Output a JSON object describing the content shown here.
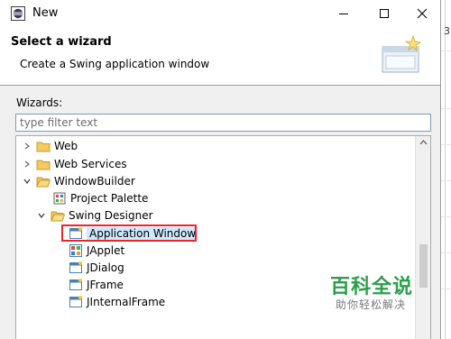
{
  "window": {
    "title": "New",
    "minimize_glyph": "—",
    "maximize_glyph": "☐",
    "close_glyph": "✕"
  },
  "header": {
    "title": "Select a wizard",
    "subtitle": "Create a Swing application window"
  },
  "wizards": {
    "label": "Wizards:",
    "filter_placeholder": "type filter text",
    "filter_value": ""
  },
  "tree": {
    "items": [
      {
        "label": "Web",
        "depth": 0,
        "expanded": false,
        "icon": "folder-icon"
      },
      {
        "label": "Web Services",
        "depth": 0,
        "expanded": false,
        "icon": "folder-icon"
      },
      {
        "label": "WindowBuilder",
        "depth": 0,
        "expanded": true,
        "icon": "folder-open-icon"
      },
      {
        "label": "Project Palette",
        "depth": 1,
        "icon": "palette-icon"
      },
      {
        "label": "Swing Designer",
        "depth": 1,
        "expanded": true,
        "icon": "folder-open-icon"
      },
      {
        "label": "Application Window",
        "depth": 2,
        "icon": "window-icon",
        "selected": true
      },
      {
        "label": "JApplet",
        "depth": 2,
        "icon": "applet-icon"
      },
      {
        "label": "JDialog",
        "depth": 2,
        "icon": "window-icon"
      },
      {
        "label": "JFrame",
        "depth": 2,
        "icon": "window-icon"
      },
      {
        "label": "JInternalFrame",
        "depth": 2,
        "icon": "window-icon"
      }
    ]
  },
  "watermark": {
    "main": "百科全说",
    "sub": "助你轻松解决"
  },
  "background": {
    "edge_char": "3\""
  },
  "colors": {
    "selection": "#cde8ff",
    "highlight_box": "#e8262b",
    "folder": "#e8b93c",
    "watermark_green": "#2aa04a"
  }
}
